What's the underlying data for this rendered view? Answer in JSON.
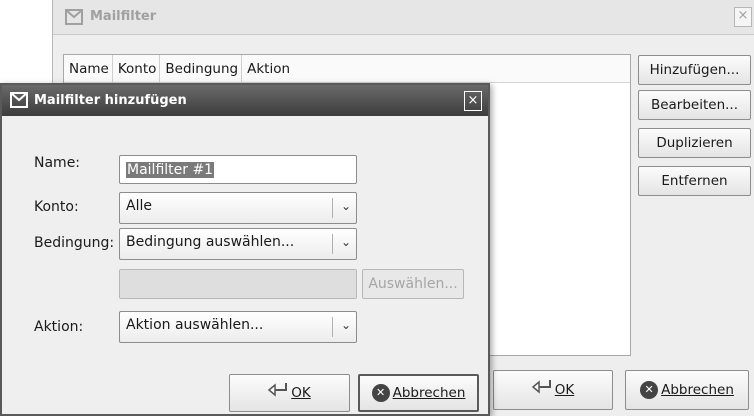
{
  "bg_window": {
    "title": "Mailfilter",
    "close": "×",
    "columns": [
      "Name",
      "Konto",
      "Bedingung",
      "Aktion"
    ],
    "side_buttons": {
      "add": "Hinzufügen...",
      "edit": "Bearbeiten...",
      "duplicate": "Duplizieren",
      "remove": "Entfernen"
    },
    "ok_label": "OK",
    "cancel_label": "Abbrechen"
  },
  "dialog": {
    "title": "Mailfilter hinzufügen",
    "close": "×",
    "name_label": "Name:",
    "name_value": "Mailfilter #1",
    "account_label": "Konto:",
    "account_value": "Alle",
    "condition_label": "Bedingung:",
    "condition_value": "Bedingung auswählen...",
    "choose_button": "Auswählen...",
    "action_label": "Aktion:",
    "action_value": "Aktion auswählen...",
    "ok_label": "OK",
    "cancel_label": "Abbrechen",
    "dropdown_arrow": "⌄"
  }
}
